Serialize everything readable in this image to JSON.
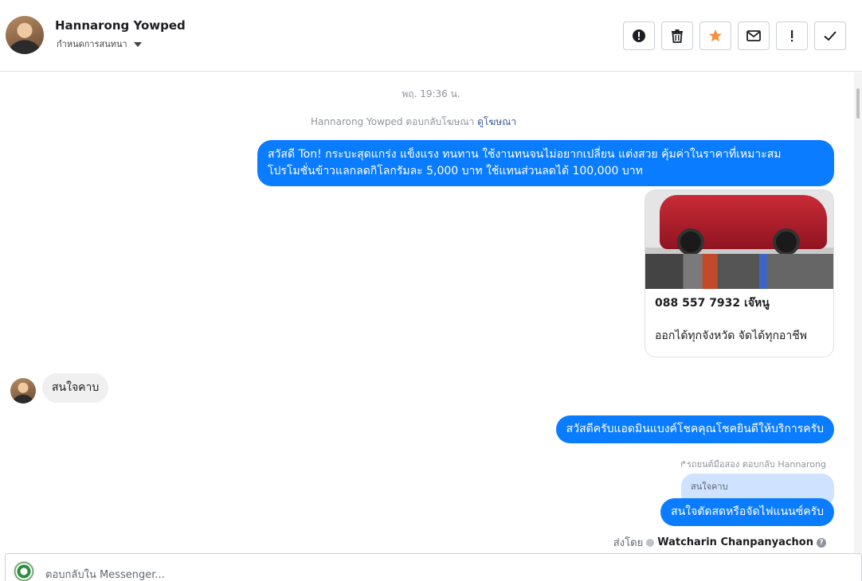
{
  "header": {
    "name": "Hannarong Yowped",
    "subtitle": "กำหนดการสนทนา",
    "toolbar": [
      {
        "id": "spam",
        "icon": "alert-circle-icon",
        "label": "!"
      },
      {
        "id": "delete",
        "icon": "trash-icon"
      },
      {
        "id": "star",
        "icon": "star-icon",
        "color": "#f7923b"
      },
      {
        "id": "unread",
        "icon": "envelope-icon"
      },
      {
        "id": "followup",
        "icon": "exclamation-icon",
        "label": "!"
      },
      {
        "id": "done",
        "icon": "checkmark-icon"
      }
    ]
  },
  "thread": {
    "timestamp": "พฤ. 19:36 น.",
    "ad_reply_text": "Hannarong Yowped ตอบกลับโฆษณา",
    "ad_reply_link": "ดูโฆษณา",
    "message_1_line1": "สวัสดี Ton! กระบะสุดแกร่ง แข็งแรง ทนทาน ใช้งานทนจนไม่อยากเปลี่ยน แต่งสวย คุ้มค่าในราคาที่เหมาะสม",
    "message_1_line2": "โปรโมชั่นข้าวแลกลดกิโลกรัมละ 5,000 บาท ใช้แทนส่วนลดได้ 100,000 บาท",
    "card": {
      "line1": "088 557 7932 เจ๊หนู",
      "line2": "ออกได้ทุกจังหวัด จัดได้ทุกอาชีพ"
    },
    "incoming_message": "สนใจคาบ",
    "message_2": "สวัสดีครับแอดมินแบงค์โชคคุณโชคยินดีให้บริการครับ",
    "reply_meta": "รถยนต์มือสอง ตอบกลับ Hannarong",
    "quoted_text": "สนใจคาบ",
    "message_3": "สนใจตัดสดหรือจัดไฟแนนซ์ครับ",
    "sent_by_label": "ส่งโดย",
    "sent_by_name": "Watcharin Chanpanyachon",
    "help_mark": "?"
  },
  "composer": {
    "placeholder": "ตอบกลับใน Messenger..."
  },
  "colors": {
    "outgoing_bubble": "#0a7cff",
    "incoming_bubble": "#f1f0f0",
    "quoted_bubble": "#cfe2ff",
    "star": "#f7923b",
    "link": "#3b5998"
  }
}
